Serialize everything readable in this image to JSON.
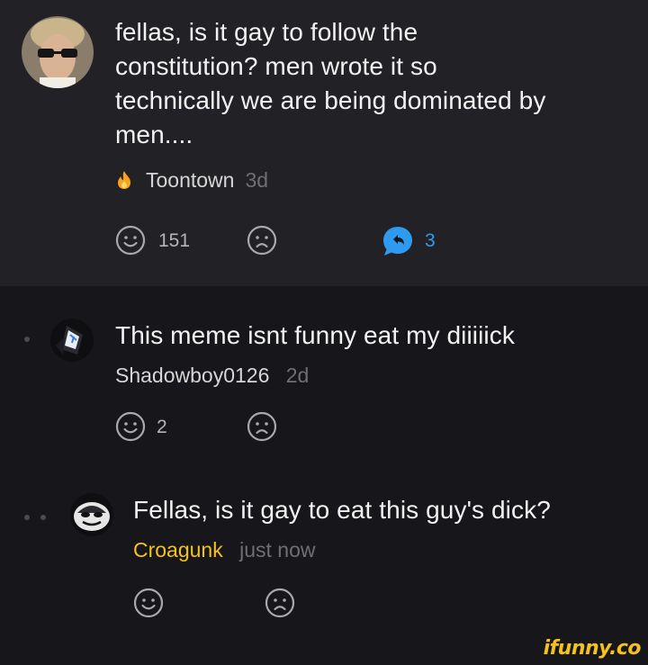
{
  "post": {
    "text_lines": [
      "fellas, is it gay to follow the",
      "constitution? men wrote it so",
      "technically we are being dominated by",
      "men...."
    ],
    "author": "Toontown",
    "time": "3d",
    "smile_count": "151",
    "reply_count": "3"
  },
  "comment1": {
    "text": "This meme isnt funny eat my diiiiick",
    "author": "Shadowboy0126",
    "time": "2d",
    "smile_count": "2"
  },
  "comment2": {
    "text": "Fellas, is it gay to eat this guy's dick?",
    "author": "Croagunk",
    "time": "just now"
  },
  "watermark": "ifunny.co",
  "colors": {
    "background": "#17171b",
    "post_background": "#222226",
    "accent_gold": "#f4c218",
    "reply_blue": "#2f9bf0",
    "fire_orange": "#f4a51c"
  },
  "icons": [
    "fire-icon",
    "smile-icon",
    "frown-icon",
    "reply-bubble-icon"
  ]
}
